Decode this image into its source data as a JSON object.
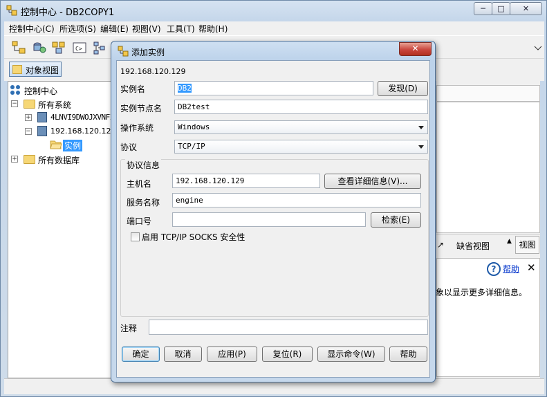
{
  "window": {
    "title": "控制中心 - DB2COPY1",
    "caption_buttons": [
      "minimize-icon",
      "maximize-icon",
      "close-icon"
    ]
  },
  "menubar": {
    "items": [
      "控制中心(C)",
      "所选项(S)",
      "编辑(E)",
      "视图(V)",
      "工具(T)",
      "帮助(H)"
    ]
  },
  "viewbar": {
    "object_view_label": "对象视图"
  },
  "tree": {
    "nodes": [
      {
        "label": "控制中心"
      },
      {
        "label": "所有系统"
      },
      {
        "label": "4LNVI9DWOJXVNFI"
      },
      {
        "label": "192.168.120.129"
      },
      {
        "label": "实例"
      },
      {
        "label": "所有数据库"
      }
    ]
  },
  "right_panel": {
    "default_view_label": "缺省视图",
    "view_label": "视图",
    "help_link": "帮助",
    "info_text": "象以显示更多详细信息。"
  },
  "dialog": {
    "title": "添加实例",
    "host_header": "192.168.120.129",
    "instance_name_label": "实例名",
    "instance_name_value": "DB2",
    "discover_button": "发现(D)",
    "node_name_label": "实例节点名",
    "node_name_value": "DB2test",
    "os_label": "操作系统",
    "os_value": "Windows",
    "protocol_label": "协议",
    "protocol_value": "TCP/IP",
    "protocol_info_group": "协议信息",
    "hostname_label": "主机名",
    "hostname_value": "192.168.120.129",
    "details_button": "查看详细信息(V)...",
    "service_label": "服务名称",
    "service_value": "engine",
    "port_label": "端口号",
    "port_value": "",
    "search_button": "检索(E)",
    "socks_checkbox_label": "启用 TCP/IP SOCKS 安全性",
    "socks_checked": false,
    "comment_label": "注释",
    "comment_value": "",
    "buttons": {
      "ok": "确定",
      "cancel": "取消",
      "apply": "应用(P)",
      "reset": "复位(R)",
      "show_command": "显示命令(W)",
      "help": "帮助"
    }
  },
  "colors": {
    "selection": "#3399ff",
    "title_gradient_top": "#d6e3f1",
    "close_button": "#c9463d",
    "default_button_border": "#3c7fb1"
  }
}
